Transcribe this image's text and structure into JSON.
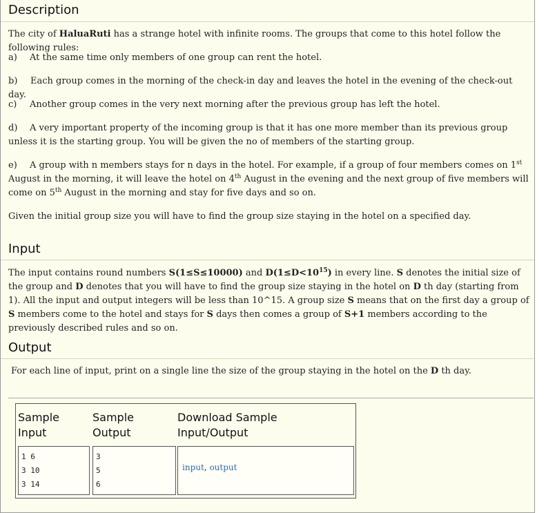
{
  "description": {
    "heading": "Description",
    "intro_pre": "The city of ",
    "city": "HaluaRuti",
    "intro_post": " has a strange hotel with infinite rooms. The groups that come to this hotel follow the following rules:",
    "rule_a_label": "a)",
    "rule_a": "At the same time only members of one group can rent the hotel.",
    "rule_b_label": "b)",
    "rule_b": "Each group comes in the morning of the check-in day and leaves the hotel in the evening of the check-out day.",
    "rule_c_label": "c)",
    "rule_c": "Another group comes in the very next morning after the previous group has left the hotel.",
    "rule_d_label": "d)",
    "rule_d": "A very important property of the incoming group is that it has one more member than its previous group unless it is the starting group. You will be given the no of members of the starting group.",
    "rule_e_label": "e)",
    "rule_e_1": "A group with n members stays for n days in the hotel. For example, if a group of four members comes on 1",
    "rule_e_sup1": "st",
    "rule_e_2": " August in the morning, it will leave the hotel on 4",
    "rule_e_sup2": "th",
    "rule_e_3": " August in the evening and the next group of five members will come on 5",
    "rule_e_sup3": "th",
    "rule_e_4": " August in the morning and stay for five days and so on.",
    "closing": "Given the initial group size you will have to find the group size staying in the hotel on a specified day."
  },
  "input": {
    "heading": "Input",
    "p1": "The input contains round numbers ",
    "s_range": "S(1≤S≤10000)",
    "and": " and ",
    "d_range": "D(1≤D<10",
    "d_sup": "15",
    "d_close": ")",
    "p2": " in every line. ",
    "s1": "S",
    "p3": " denotes the initial size of the group and ",
    "d1": "D",
    "p4": " denotes that you will have to find the group size staying in the hotel on ",
    "d2": "D",
    "p5": " th day (starting from 1). All the input and output integers will be less than 10^15. A group size ",
    "s2": "S",
    "p6": " means that on the first day a group of ",
    "s3": "S",
    "p7": " members come to the hotel and stays for ",
    "s4": "S",
    "p8": " days then comes a group of ",
    "s5": "S+1",
    "p9": " members according to the previously described rules and so on."
  },
  "output": {
    "heading": "Output",
    "p1": "For each line of input, print on a single line the size of the group staying in the hotel on the ",
    "d": "D",
    "p2": " th day."
  },
  "sample": {
    "input_header_1": "Sample",
    "input_header_2": "Input",
    "output_header_1": "Sample",
    "output_header_2": "Output",
    "download_header_1": "Download Sample",
    "download_header_2": "Input/Output",
    "input_lines": "1 6\n3 10\n3 14",
    "output_lines": "3\n5\n6",
    "link_input": "input",
    "link_sep": ", ",
    "link_output": "output"
  }
}
